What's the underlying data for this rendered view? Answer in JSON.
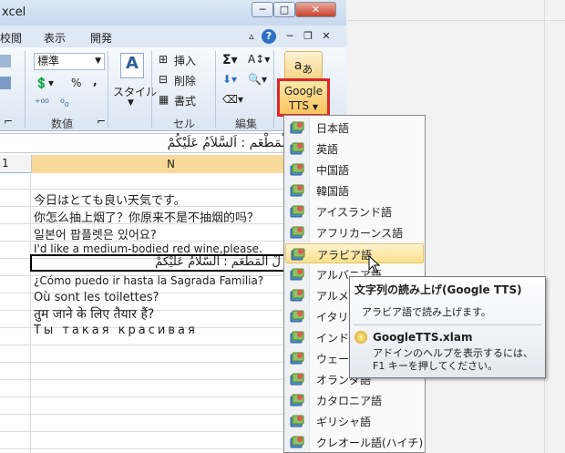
{
  "window": {
    "title": "xcel"
  },
  "tabs": [
    "校閲",
    "表示",
    "開発"
  ],
  "ribbon": {
    "number_format": "標準",
    "style_label": "スタイル",
    "insert_label": "挿入",
    "delete_label": "削除",
    "format_label": "書式",
    "percent": "%",
    "comma": ",",
    "group_number": "数値",
    "group_cells": "セル",
    "group_edit": "編集",
    "google_tts_label": "Google TTS",
    "google_tts_line1": "Google",
    "google_tts_line2": "TTS"
  },
  "formula_bar": {
    "text": "لْ أَلْمَطْعَم : اَلسَّلاَمُ عَلَيْكُمْ"
  },
  "columns": {
    "row_partial": "1",
    "col_name": "N"
  },
  "cells": [
    "今日はとても良い天気です。",
    "你怎么抽上烟了？你原来不是不抽烟的吗？",
    "일본어 팝플렛은 있어요?",
    "I'd like a medium-bodied red wine,please.",
    "لْ أَلْمَطْعَم : اَلسَّلاَمُ عَلَيْكُمْ",
    "¿Cómo puedo ir hasta la Sagrada Familia?",
    "Où sont les toilettes?",
    "तुम जाने के लिए तैयार हैं?",
    "Ты такая красивая"
  ],
  "menu": {
    "items": [
      "日本語",
      "英語",
      "中国語",
      "韓国語",
      "アイスランド語",
      "アフリカーンス語",
      "アラビア語",
      "アルバニア語",
      "アルメニア語",
      "イタリア語",
      "インドネシア語",
      "ウェールズ語",
      "オランダ語",
      "カタロニア語",
      "ギリシャ語",
      "クレオール語(ハイチ)"
    ],
    "highlighted_index": 6
  },
  "tooltip": {
    "title": "文字列の読み上げ(Google TTS)",
    "description": "アラビア語で読み上げます。",
    "addin_name": "GoogleTTS.xlam",
    "help_text": "アドインのヘルプを表示するには、F1 キーを押してください。"
  },
  "colors": {
    "accent_red": "#e0262a",
    "highlight": "#fbe18c",
    "header_selected": "#f9d99a"
  }
}
